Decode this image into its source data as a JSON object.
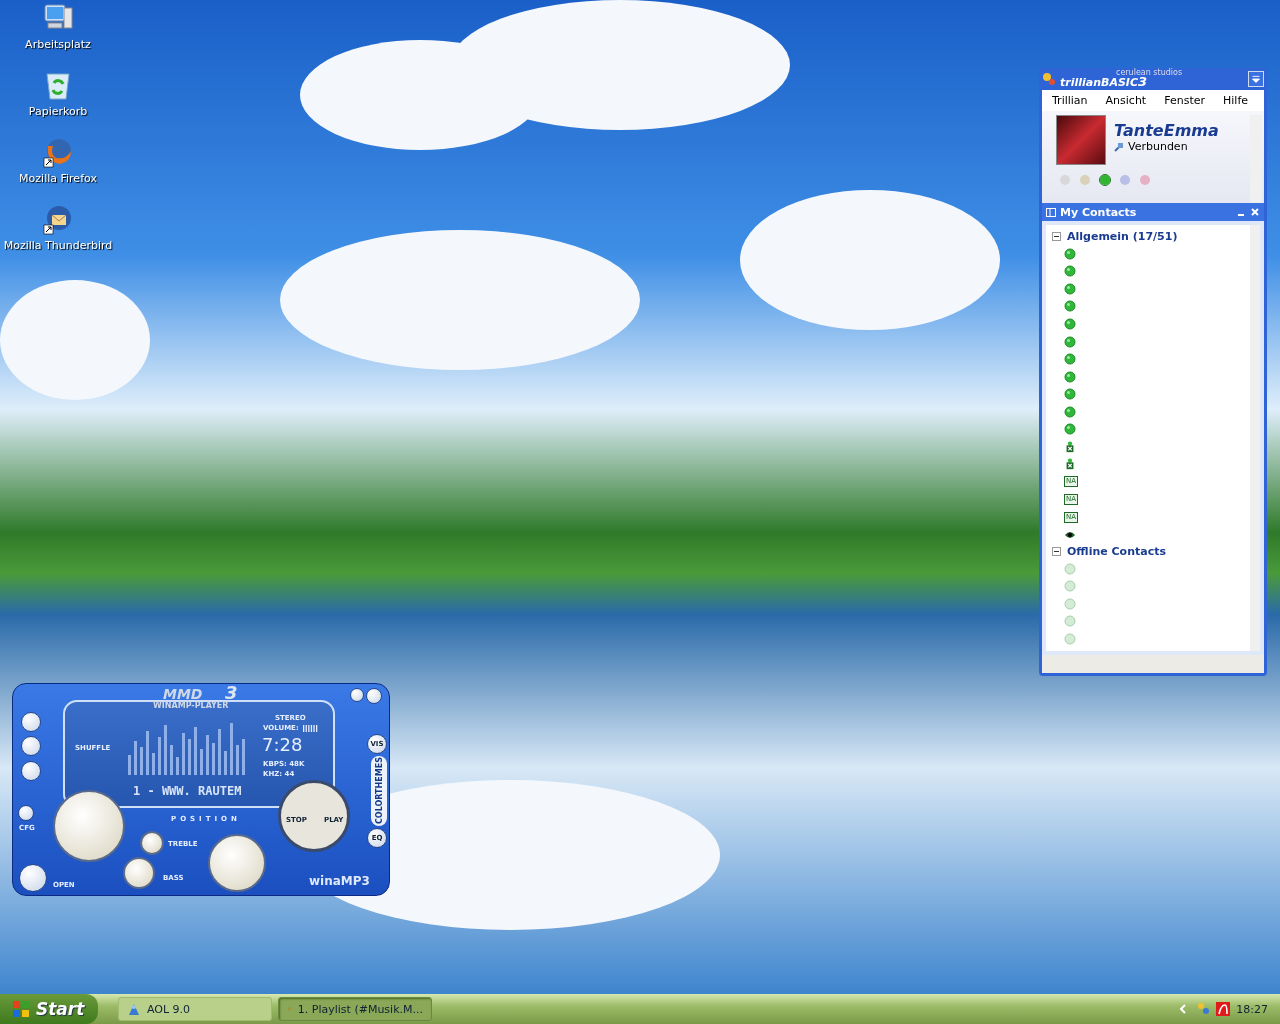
{
  "desktop_icons": [
    {
      "label": "Arbeitsplatz",
      "kind": "computer"
    },
    {
      "label": "Papierkorb",
      "kind": "trash"
    },
    {
      "label": "Mozilla Firefox",
      "kind": "browser"
    },
    {
      "label": "Mozilla Thunderbird",
      "kind": "mail"
    }
  ],
  "trillian": {
    "brand_small": "cerulean studios",
    "brand": "trillianBASIC",
    "brand_number": "3",
    "menu": [
      "Trillian",
      "Ansicht",
      "Fenster",
      "Hilfe"
    ],
    "profile": {
      "name": "TanteEmma",
      "status": "Verbunden"
    },
    "status_buttons": [
      {
        "color": "#d8d8d8",
        "selected": false
      },
      {
        "color": "#d9d2b8",
        "selected": false
      },
      {
        "color": "#2fb52f",
        "selected": true
      },
      {
        "color": "#b8bfe8",
        "selected": false
      },
      {
        "color": "#e8b0c4",
        "selected": false
      }
    ],
    "contacts_title": "My Contacts",
    "groups": [
      {
        "label": "Allgemein (17/51)",
        "expanded": true,
        "contacts": [
          {
            "kind": "online"
          },
          {
            "kind": "online"
          },
          {
            "kind": "online"
          },
          {
            "kind": "online"
          },
          {
            "kind": "online"
          },
          {
            "kind": "online"
          },
          {
            "kind": "online"
          },
          {
            "kind": "online"
          },
          {
            "kind": "online"
          },
          {
            "kind": "online"
          },
          {
            "kind": "online"
          },
          {
            "kind": "away"
          },
          {
            "kind": "away"
          },
          {
            "kind": "na",
            "badge": "NA"
          },
          {
            "kind": "na",
            "badge": "NA"
          },
          {
            "kind": "na",
            "badge": "NA"
          },
          {
            "kind": "invisible"
          }
        ]
      },
      {
        "label": "Offline Contacts",
        "expanded": true,
        "contacts": [
          {
            "kind": "offline"
          },
          {
            "kind": "offline"
          },
          {
            "kind": "offline"
          },
          {
            "kind": "offline"
          },
          {
            "kind": "offline"
          }
        ]
      }
    ]
  },
  "player": {
    "logo": "MMD",
    "logo_number": "3",
    "logo_sub": "WINAMP-PLAYER",
    "shuffle": "SHUFFLE",
    "stereo": "STEREO",
    "volume": "VOLUME:",
    "time": "7:28",
    "kbps": "KBPS: 48K",
    "khz": "KHZ: 44",
    "marquee": "1 - WWW. RAUTEM",
    "position": "POSITION",
    "stop": "STOP",
    "play": "PLAY",
    "treble": "TREBLE",
    "bass": "BASS",
    "cfg": "CFG",
    "open": "OPEN",
    "vis": "VIS",
    "eq": "EQ",
    "colorthemes": "COLORTHEMES",
    "brand": "winaMP3"
  },
  "taskbar": {
    "start": "Start",
    "tasks": [
      {
        "label": "AOL 9.0",
        "selected": false,
        "kind": "aol"
      },
      {
        "label": "1. Playlist (#Musik.M...",
        "selected": true,
        "kind": "player"
      }
    ],
    "clock": "18:27"
  }
}
